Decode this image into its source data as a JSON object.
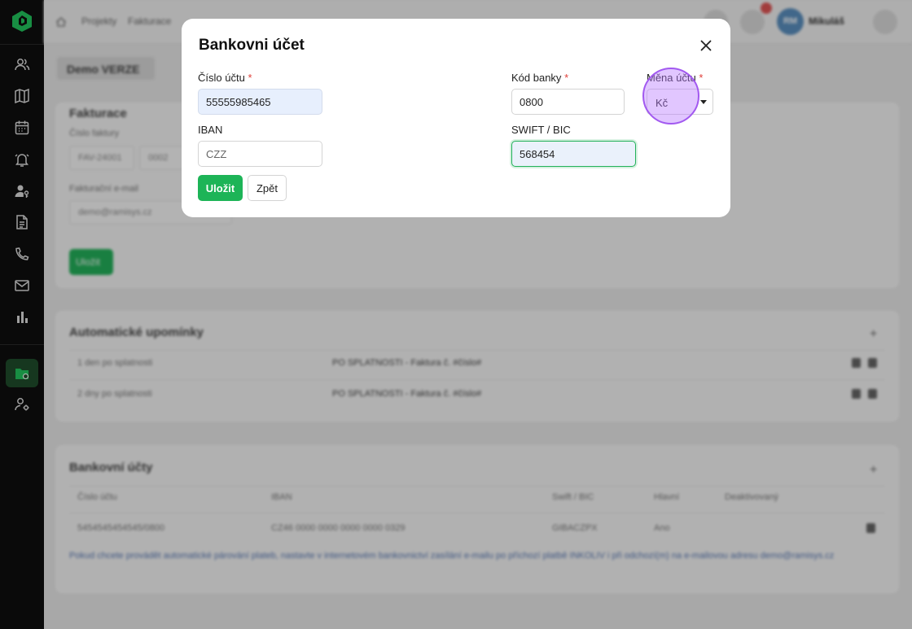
{
  "sidebar": {
    "items": [
      "users-icon",
      "map-icon",
      "calendar-icon",
      "bell-icon",
      "user-key-icon",
      "document-icon",
      "phone-icon",
      "mail-icon",
      "chart-icon",
      "folder-icon",
      "user-settings-icon"
    ],
    "active": "folder-icon"
  },
  "background": {
    "breadcrumb": [
      "Projekty",
      "Fakturace"
    ],
    "user_initials": "RM",
    "user_name": "Mikuláš",
    "demo_label": "Demo VERZE",
    "invoicing": {
      "title": "Fakturace",
      "invoice_number_label": "Číslo faktury",
      "invoice_prefix": "FAV-24001",
      "invoice_suffix": "0002",
      "email_label": "Fakturační e-mail",
      "email_value": "demo@ramisys.cz",
      "save_label": "Uložit"
    },
    "reminders": {
      "title": "Automatické upomínky",
      "rows": [
        {
          "when": "1 den po splatnosti",
          "template": "PO SPLATNOSTI - Faktura č. #číslo#"
        },
        {
          "when": "2 dny po splatnosti",
          "template": "PO SPLATNOSTI - Faktura č. #číslo#"
        }
      ]
    },
    "bank_accounts": {
      "title": "Bankovní účty",
      "columns": [
        "Číslo účtu",
        "IBAN",
        "Swift / BIC",
        "Hlavní",
        "Deaktivovaný"
      ],
      "rows": [
        {
          "account": "5454545454545/0800",
          "iban": "CZ46 0000 0000 0000 0000 0329",
          "swift": "GIBACZPX",
          "main": "Ano"
        }
      ],
      "note": "Pokud chcete provádět automatické párování plateb, nastavte v internetovém bankovnictví zasílání e-mailu po příchozí platbě INKOLIV i při odchozí(m) na e-mailovou adresu demo@ramisys.cz"
    }
  },
  "modal": {
    "title": "Bankovni účet",
    "account_label": "Číslo účtu",
    "account_value": "55555985465",
    "bank_code_label": "Kód banky",
    "bank_code_value": "0800",
    "currency_label": "Měna účtu",
    "currency_value": "Kč",
    "iban_label": "IBAN",
    "iban_placeholder": "CZZ",
    "swift_label": "SWIFT / BIC",
    "swift_value": "568454",
    "save_label": "Uložit",
    "back_label": "Zpět",
    "required_mark": "*"
  },
  "colors": {
    "accent": "#1db457",
    "sidebar_bg": "#0e0e0e",
    "required": "#e0403a",
    "cursor_ring": "#a259f0"
  }
}
